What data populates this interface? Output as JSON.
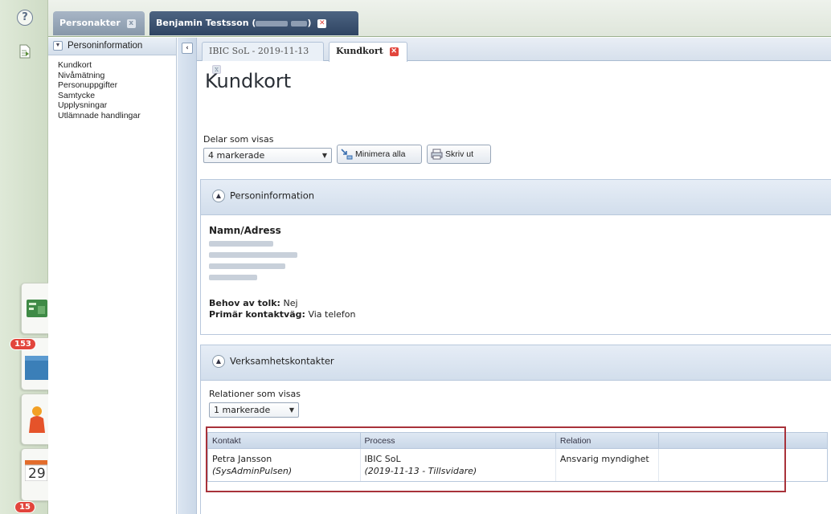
{
  "rail": {
    "help_label": "?",
    "badge_messages": "153",
    "calendar_day": "29",
    "badge_bottom": "15"
  },
  "top_tabs": [
    {
      "label": "Personakter",
      "close": "x"
    },
    {
      "label_prefix": "Benjamin Testsson (",
      "label_suffix": ")",
      "close": "✕"
    }
  ],
  "person_sidebar": {
    "header": "Personinformation",
    "items": [
      "Kundkort",
      "Nivåmätning",
      "Personuppgifter",
      "Samtycke",
      "Upplysningar",
      "Utlämnade handlingar"
    ]
  },
  "sub_tabs": [
    {
      "label": "IBIC SoL - 2019-11-13",
      "close": "x"
    },
    {
      "label": "Kundkort",
      "close": "✕"
    }
  ],
  "page": {
    "title": "Kundkort",
    "delar_label": "Delar som visas",
    "delar_value": "4 markerade",
    "minimize_label": "Minimera alla",
    "print_label": "Skriv ut"
  },
  "person_panel": {
    "title": "Personinformation",
    "name_address_label": "Namn/Adress",
    "interpreter_label": "Behov av tolk:",
    "interpreter_value": "Nej",
    "contact_label": "Primär kontaktväg:",
    "contact_value": "Via telefon"
  },
  "contacts_panel": {
    "title": "Verksamhetskontakter",
    "relations_label": "Relationer som visas",
    "relations_value": "1 markerade",
    "columns": [
      "Kontakt",
      "Process",
      "Relation",
      ""
    ],
    "rows": [
      {
        "contact_name": "Petra Jansson",
        "contact_sub": "(SysAdminPulsen)",
        "process_name": "IBIC SoL",
        "process_sub": "(2019-11-13 - Tillsvidare)",
        "relation": "Ansvarig myndighet"
      }
    ]
  },
  "colors": {
    "highlight_outline": "#a8323a",
    "badge": "#e2453c",
    "active_tab": "#2e4462"
  }
}
